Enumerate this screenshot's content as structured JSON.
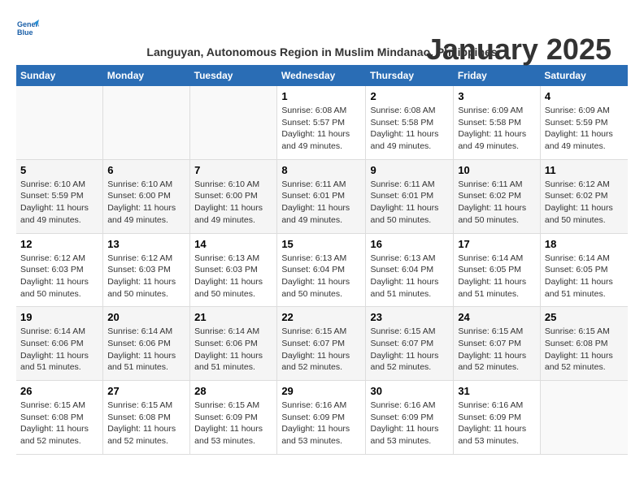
{
  "header": {
    "logo_line1": "General",
    "logo_line2": "Blue",
    "title": "January 2025",
    "subtitle": "Languyan, Autonomous Region in Muslim Mindanao, Philippines"
  },
  "days_of_week": [
    "Sunday",
    "Monday",
    "Tuesday",
    "Wednesday",
    "Thursday",
    "Friday",
    "Saturday"
  ],
  "weeks": [
    {
      "days": [
        {
          "num": "",
          "info": ""
        },
        {
          "num": "",
          "info": ""
        },
        {
          "num": "",
          "info": ""
        },
        {
          "num": "1",
          "info": "Sunrise: 6:08 AM\nSunset: 5:57 PM\nDaylight: 11 hours and 49 minutes."
        },
        {
          "num": "2",
          "info": "Sunrise: 6:08 AM\nSunset: 5:58 PM\nDaylight: 11 hours and 49 minutes."
        },
        {
          "num": "3",
          "info": "Sunrise: 6:09 AM\nSunset: 5:58 PM\nDaylight: 11 hours and 49 minutes."
        },
        {
          "num": "4",
          "info": "Sunrise: 6:09 AM\nSunset: 5:59 PM\nDaylight: 11 hours and 49 minutes."
        }
      ]
    },
    {
      "days": [
        {
          "num": "5",
          "info": "Sunrise: 6:10 AM\nSunset: 5:59 PM\nDaylight: 11 hours and 49 minutes."
        },
        {
          "num": "6",
          "info": "Sunrise: 6:10 AM\nSunset: 6:00 PM\nDaylight: 11 hours and 49 minutes."
        },
        {
          "num": "7",
          "info": "Sunrise: 6:10 AM\nSunset: 6:00 PM\nDaylight: 11 hours and 49 minutes."
        },
        {
          "num": "8",
          "info": "Sunrise: 6:11 AM\nSunset: 6:01 PM\nDaylight: 11 hours and 49 minutes."
        },
        {
          "num": "9",
          "info": "Sunrise: 6:11 AM\nSunset: 6:01 PM\nDaylight: 11 hours and 50 minutes."
        },
        {
          "num": "10",
          "info": "Sunrise: 6:11 AM\nSunset: 6:02 PM\nDaylight: 11 hours and 50 minutes."
        },
        {
          "num": "11",
          "info": "Sunrise: 6:12 AM\nSunset: 6:02 PM\nDaylight: 11 hours and 50 minutes."
        }
      ]
    },
    {
      "days": [
        {
          "num": "12",
          "info": "Sunrise: 6:12 AM\nSunset: 6:03 PM\nDaylight: 11 hours and 50 minutes."
        },
        {
          "num": "13",
          "info": "Sunrise: 6:12 AM\nSunset: 6:03 PM\nDaylight: 11 hours and 50 minutes."
        },
        {
          "num": "14",
          "info": "Sunrise: 6:13 AM\nSunset: 6:03 PM\nDaylight: 11 hours and 50 minutes."
        },
        {
          "num": "15",
          "info": "Sunrise: 6:13 AM\nSunset: 6:04 PM\nDaylight: 11 hours and 50 minutes."
        },
        {
          "num": "16",
          "info": "Sunrise: 6:13 AM\nSunset: 6:04 PM\nDaylight: 11 hours and 51 minutes."
        },
        {
          "num": "17",
          "info": "Sunrise: 6:14 AM\nSunset: 6:05 PM\nDaylight: 11 hours and 51 minutes."
        },
        {
          "num": "18",
          "info": "Sunrise: 6:14 AM\nSunset: 6:05 PM\nDaylight: 11 hours and 51 minutes."
        }
      ]
    },
    {
      "days": [
        {
          "num": "19",
          "info": "Sunrise: 6:14 AM\nSunset: 6:06 PM\nDaylight: 11 hours and 51 minutes."
        },
        {
          "num": "20",
          "info": "Sunrise: 6:14 AM\nSunset: 6:06 PM\nDaylight: 11 hours and 51 minutes."
        },
        {
          "num": "21",
          "info": "Sunrise: 6:14 AM\nSunset: 6:06 PM\nDaylight: 11 hours and 51 minutes."
        },
        {
          "num": "22",
          "info": "Sunrise: 6:15 AM\nSunset: 6:07 PM\nDaylight: 11 hours and 52 minutes."
        },
        {
          "num": "23",
          "info": "Sunrise: 6:15 AM\nSunset: 6:07 PM\nDaylight: 11 hours and 52 minutes."
        },
        {
          "num": "24",
          "info": "Sunrise: 6:15 AM\nSunset: 6:07 PM\nDaylight: 11 hours and 52 minutes."
        },
        {
          "num": "25",
          "info": "Sunrise: 6:15 AM\nSunset: 6:08 PM\nDaylight: 11 hours and 52 minutes."
        }
      ]
    },
    {
      "days": [
        {
          "num": "26",
          "info": "Sunrise: 6:15 AM\nSunset: 6:08 PM\nDaylight: 11 hours and 52 minutes."
        },
        {
          "num": "27",
          "info": "Sunrise: 6:15 AM\nSunset: 6:08 PM\nDaylight: 11 hours and 52 minutes."
        },
        {
          "num": "28",
          "info": "Sunrise: 6:15 AM\nSunset: 6:09 PM\nDaylight: 11 hours and 53 minutes."
        },
        {
          "num": "29",
          "info": "Sunrise: 6:16 AM\nSunset: 6:09 PM\nDaylight: 11 hours and 53 minutes."
        },
        {
          "num": "30",
          "info": "Sunrise: 6:16 AM\nSunset: 6:09 PM\nDaylight: 11 hours and 53 minutes."
        },
        {
          "num": "31",
          "info": "Sunrise: 6:16 AM\nSunset: 6:09 PM\nDaylight: 11 hours and 53 minutes."
        },
        {
          "num": "",
          "info": ""
        }
      ]
    }
  ]
}
